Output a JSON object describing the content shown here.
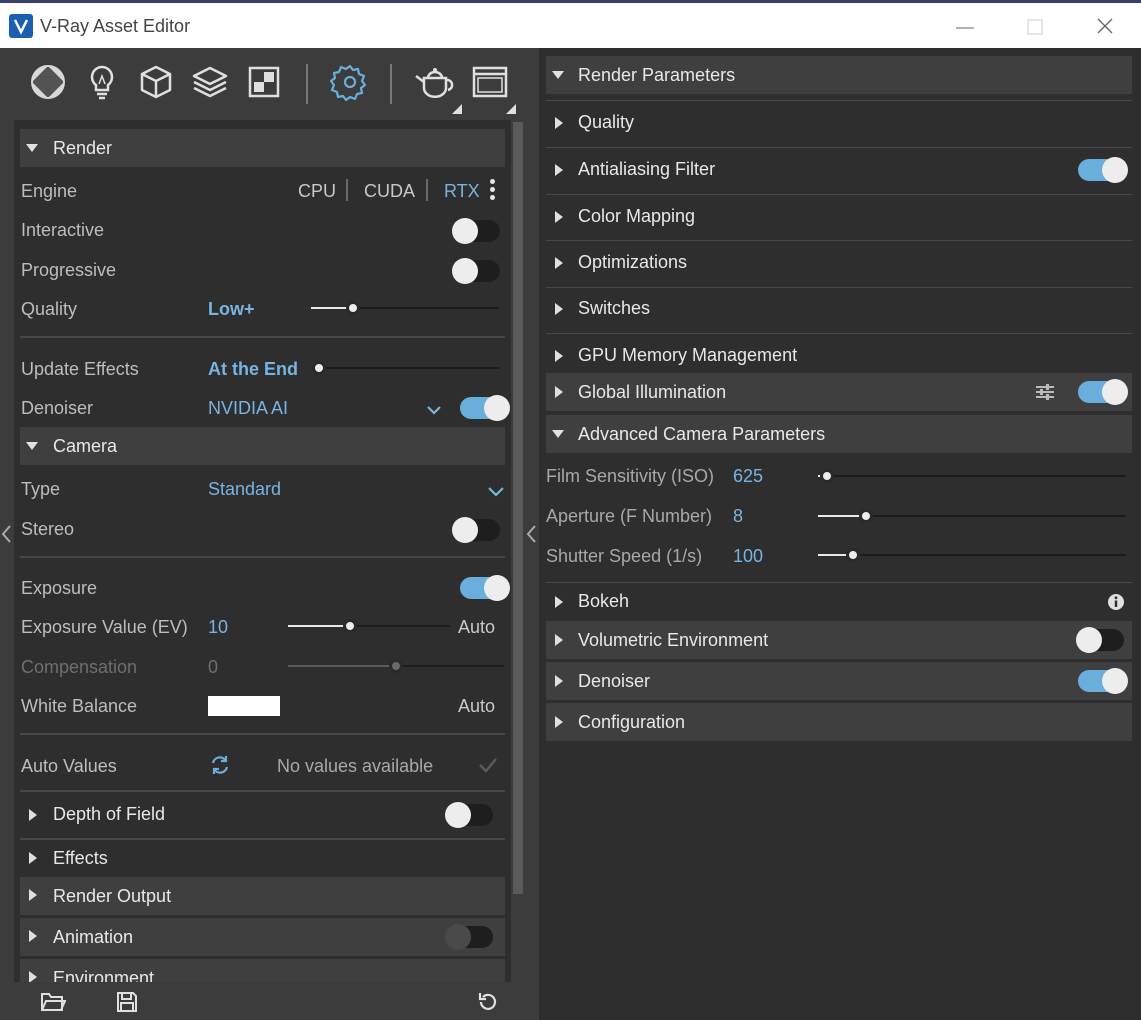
{
  "window": {
    "title": "V-Ray Asset Editor"
  },
  "render": {
    "header": "Render",
    "engine_label": "Engine",
    "engines": [
      "CPU",
      "CUDA",
      "RTX"
    ],
    "active_engine": "RTX",
    "interactive_label": "Interactive",
    "interactive_on": false,
    "progressive_label": "Progressive",
    "progressive_on": false,
    "quality_label": "Quality",
    "quality_value": "Low+",
    "quality_fraction": 0.22,
    "update_effects_label": "Update Effects",
    "update_effects_value": "At the End",
    "update_effects_fraction": 0.0,
    "denoiser_label": "Denoiser",
    "denoiser_value": "NVIDIA AI",
    "denoiser_on": true
  },
  "camera": {
    "header": "Camera",
    "type_label": "Type",
    "type_value": "Standard",
    "stereo_label": "Stereo",
    "stereo_on": false,
    "exposure_label": "Exposure",
    "exposure_on": true,
    "ev_label": "Exposure Value (EV)",
    "ev_value": "10",
    "ev_auto": "Auto",
    "compensation_label": "Compensation",
    "compensation_value": "0",
    "wb_label": "White Balance",
    "wb_color": "#ffffff",
    "wb_auto": "Auto",
    "auto_values_label": "Auto Values",
    "auto_values_status": "No values available"
  },
  "left_sections": {
    "dof": "Depth of Field",
    "dof_on": false,
    "effects": "Effects",
    "render_output": "Render Output",
    "animation": "Animation",
    "animation_on": false,
    "environment": "Environment"
  },
  "right": {
    "render_parameters": "Render Parameters",
    "quality": "Quality",
    "antialiasing": "Antialiasing Filter",
    "antialiasing_on": true,
    "color_mapping": "Color Mapping",
    "optimizations": "Optimizations",
    "switches": "Switches",
    "gpu_memory": "GPU Memory Management",
    "global_illumination": "Global Illumination",
    "gi_on": true,
    "advanced_camera": "Advanced Camera Parameters",
    "iso_label": "Film Sensitivity (ISO)",
    "iso_value": "625",
    "aperture_label": "Aperture (F Number)",
    "aperture_value": "8",
    "shutter_label": "Shutter Speed (1/s)",
    "shutter_value": "100",
    "bokeh": "Bokeh",
    "volumetric": "Volumetric Environment",
    "volumetric_on": false,
    "denoiser": "Denoiser",
    "denoiser_on": true,
    "configuration": "Configuration"
  },
  "colors": {
    "accent": "#6aaedb",
    "value_text": "#78b4e0",
    "panel_bg": "#2e2e2e",
    "header_bg": "#3f3f3f"
  }
}
